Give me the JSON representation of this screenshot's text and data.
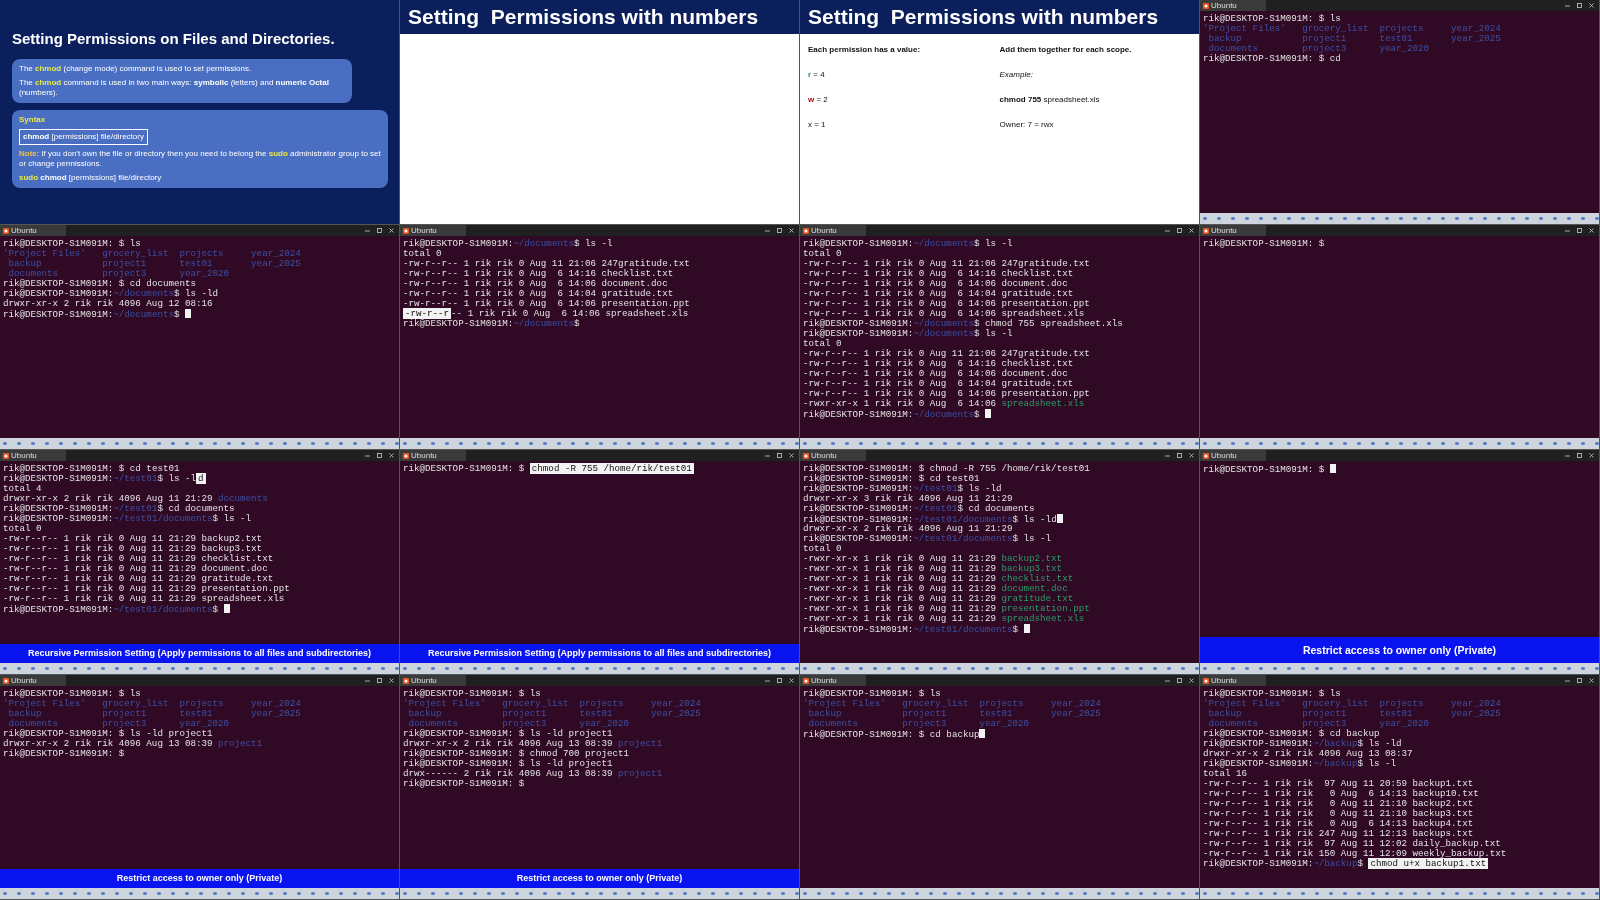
{
  "frames": [
    {
      "kind": "slide_intro",
      "title": "Setting Permissions on Files and Directories.",
      "paragraphs": [
        {
          "segments": [
            {
              "text": "The "
            },
            {
              "text": "chmod",
              "kind": "keyword"
            },
            {
              "text": " (change mode) command is used to set permissions."
            }
          ]
        },
        {
          "segments": [
            {
              "text": "The "
            },
            {
              "text": "chmod",
              "kind": "keyword"
            },
            {
              "text": " command is used in two main ways: "
            },
            {
              "text": "symbolic",
              "kind": "bold"
            },
            {
              "text": " (letters) and "
            },
            {
              "text": "numeric Octal",
              "kind": "bold"
            },
            {
              "text": " (numbers)."
            }
          ]
        }
      ],
      "syntax": {
        "heading": "Syntax",
        "code": [
          {
            "text": "chmod",
            "kind": "bold"
          },
          {
            "text": " [permissions] file/directory"
          }
        ],
        "note": [
          {
            "text": "Note",
            "kind": "note"
          },
          {
            "text": ": If you don't own the file or directory then you need to belong the  "
          },
          {
            "text": "sudo",
            "kind": "keyword"
          },
          {
            "text": " administrator group to set or change permissions."
          }
        ],
        "example": [
          {
            "text": "sudo",
            "kind": "keyword"
          },
          {
            "text": " chmod",
            "kind": "bold"
          },
          {
            "text": " [permissions] file/directory"
          }
        ]
      }
    },
    {
      "kind": "slide_numbers",
      "title": "Setting  Permissions with numbers"
    },
    {
      "kind": "slide_numbers",
      "title": "Setting  Permissions with numbers",
      "left": [
        {
          "segments": [
            {
              "text": "Each permission has a value:",
              "kind": "bold"
            }
          ]
        },
        {
          "segments": [
            {
              "text": "r",
              "kind": "green"
            },
            {
              "text": " = 4"
            }
          ]
        },
        {
          "segments": [
            {
              "text": "w",
              "kind": "red"
            },
            {
              "text": " = 2"
            }
          ]
        },
        {
          "segments": [
            {
              "text": "x = 1"
            }
          ]
        }
      ],
      "right": [
        {
          "segments": [
            {
              "text": "Add them together for each scope.",
              "kind": "bold"
            }
          ]
        },
        {
          "segments": [
            {
              "text": "Example:",
              "kind": "italic"
            }
          ]
        },
        {
          "segments": [
            {
              "text": "chmod 755",
              "kind": "bold"
            },
            {
              "text": " spreadsheet.xls"
            }
          ]
        },
        {
          "segments": [
            {
              "text": "Owner: 7 = rwx"
            }
          ]
        }
      ]
    },
    {
      "kind": "terminal",
      "tab_title": "Ubuntu",
      "lines": [
        {
          "kind": "prompt",
          "prompt": "rik@DESKTOP-S1M091M:",
          "input": " $ ls"
        },
        {
          "kind": "listing",
          "text": "'Project Files'   grocery_list  projects     year_2024"
        },
        {
          "kind": "listing",
          "text": " backup           project1      test01       year_2025"
        },
        {
          "kind": "listing",
          "text": " documents        project3      year_2020"
        },
        {
          "kind": "prompt",
          "prompt": "rik@DESKTOP-S1M091M:",
          "input": " $ cd"
        }
      ]
    },
    {
      "kind": "terminal",
      "tab_title": "Ubuntu",
      "lines": [
        {
          "kind": "prompt",
          "prompt": "rik@DESKTOP-S1M091M:",
          "input": " $ ls"
        },
        {
          "kind": "listing",
          "text": "'Project Files'   grocery_list  projects     year_2024"
        },
        {
          "kind": "listing",
          "text": " backup           project1      test01       year_2025"
        },
        {
          "kind": "listing",
          "text": " documents        project3      year_2020"
        },
        {
          "kind": "prompt",
          "prompt": "rik@DESKTOP-S1M091M:",
          "input": " $ cd documents"
        },
        {
          "kind": "prompt",
          "prompt": "rik@DESKTOP-S1M091M:",
          "path": "~/documents",
          "input": "$ ls -ld"
        },
        {
          "kind": "output",
          "text": "drwxr-xr-x 2 rik rik 4096 Aug 12 08:16"
        },
        {
          "kind": "prompt",
          "prompt": "rik@DESKTOP-S1M091M:",
          "path": "~/documents",
          "input": "$ ",
          "cursor": true
        }
      ]
    },
    {
      "kind": "terminal",
      "tab_title": "Ubuntu",
      "lines": [
        {
          "kind": "prompt",
          "prompt": "rik@DESKTOP-S1M091M:",
          "path": "~/documents",
          "input": "$ ls -l"
        },
        {
          "kind": "output",
          "text": "total 0"
        },
        {
          "kind": "output",
          "text": "-rw-r--r-- 1 rik rik 0 Aug 11 21:06 247gratitude.txt"
        },
        {
          "kind": "output",
          "text": "-rw-r--r-- 1 rik rik 0 Aug  6 14:16 checklist.txt"
        },
        {
          "kind": "output",
          "text": "-rw-r--r-- 1 rik rik 0 Aug  6 14:06 document.doc"
        },
        {
          "kind": "output",
          "text": "-rw-r--r-- 1 rik rik 0 Aug  6 14:04 gratitude.txt"
        },
        {
          "kind": "output",
          "text": "-rw-r--r-- 1 rik rik 0 Aug  6 14:06 presentation.ppt"
        },
        {
          "kind": "output",
          "selected_prefix": "-rw-r--r",
          "text": "-- 1 rik rik 0 Aug  6 14:06 spreadsheet.xls"
        },
        {
          "kind": "prompt",
          "prompt": "rik@DESKTOP-S1M091M:",
          "path": "~/documents",
          "input": "$"
        }
      ]
    },
    {
      "kind": "terminal",
      "tab_title": "Ubuntu",
      "lines": [
        {
          "kind": "prompt",
          "prompt": "rik@DESKTOP-S1M091M:",
          "path": "~/documents",
          "input": "$ ls -l"
        },
        {
          "kind": "output",
          "text": "total 0"
        },
        {
          "kind": "output",
          "text": "-rw-r--r-- 1 rik rik 0 Aug 11 21:06 247gratitude.txt"
        },
        {
          "kind": "output",
          "text": "-rw-r--r-- 1 rik rik 0 Aug  6 14:16 checklist.txt"
        },
        {
          "kind": "output",
          "text": "-rw-r--r-- 1 rik rik 0 Aug  6 14:06 document.doc"
        },
        {
          "kind": "output",
          "text": "-rw-r--r-- 1 rik rik 0 Aug  6 14:04 gratitude.txt"
        },
        {
          "kind": "output",
          "text": "-rw-r--r-- 1 rik rik 0 Aug  6 14:06 presentation.ppt"
        },
        {
          "kind": "output",
          "text": "-rw-r--r-- 1 rik rik 0 Aug  6 14:06 spreadsheet.xls"
        },
        {
          "kind": "prompt",
          "prompt": "rik@DESKTOP-S1M091M:",
          "path": "~/documents",
          "input": "$ chmod 755 spreadsheet.xls"
        },
        {
          "kind": "prompt",
          "prompt": "rik@DESKTOP-S1M091M:",
          "path": "~/documents",
          "input": "$ ls -l"
        },
        {
          "kind": "output",
          "text": "total 0"
        },
        {
          "kind": "output",
          "text": "-rw-r--r-- 1 rik rik 0 Aug 11 21:06 247gratitude.txt"
        },
        {
          "kind": "output",
          "text": "-rw-r--r-- 1 rik rik 0 Aug  6 14:16 checklist.txt"
        },
        {
          "kind": "output",
          "text": "-rw-r--r-- 1 rik rik 0 Aug  6 14:06 document.doc"
        },
        {
          "kind": "output",
          "text": "-rw-r--r-- 1 rik rik 0 Aug  6 14:04 gratitude.txt"
        },
        {
          "kind": "output",
          "text": "-rw-r--r-- 1 rik rik 0 Aug  6 14:06 presentation.ppt"
        },
        {
          "kind": "exec_entry",
          "text": "-rwxr-xr-x 1 rik rik 0 Aug  6 14:06 ",
          "name": "spreadsheet.xls"
        },
        {
          "kind": "prompt",
          "prompt": "rik@DESKTOP-S1M091M:",
          "path": "~/documents",
          "input": "$ ",
          "cursor": true
        }
      ]
    },
    {
      "kind": "terminal",
      "tab_title": "Ubuntu",
      "lines": [
        {
          "kind": "prompt",
          "prompt": "rik@DESKTOP-S1M091M:",
          "input": " $"
        }
      ]
    },
    {
      "kind": "terminal",
      "tab_title": "Ubuntu",
      "caption": "Recursive Permission Setting (Apply permissions to all files and subdirectories)",
      "lines": [
        {
          "kind": "prompt",
          "prompt": "rik@DESKTOP-S1M091M:",
          "input": " $ cd test01"
        },
        {
          "kind": "prompt",
          "prompt": "rik@DESKTOP-S1M091M:",
          "path": "~/test01",
          "input": "$ ls -l",
          "selection": "d"
        },
        {
          "kind": "output",
          "text": "total 4"
        },
        {
          "kind": "dir_entry",
          "text": "drwxr-xr-x 2 rik rik 4096 Aug 11 21:29 ",
          "name": "documents"
        },
        {
          "kind": "prompt",
          "prompt": "rik@DESKTOP-S1M091M:",
          "path": "~/test01",
          "input": "$ cd documents"
        },
        {
          "kind": "prompt",
          "prompt": "rik@DESKTOP-S1M091M:",
          "path": "~/test01/documents",
          "input": "$ ls -l"
        },
        {
          "kind": "output",
          "text": "total 0"
        },
        {
          "kind": "output",
          "text": "-rw-r--r-- 1 rik rik 0 Aug 11 21:29 backup2.txt"
        },
        {
          "kind": "output",
          "text": "-rw-r--r-- 1 rik rik 0 Aug 11 21:29 backup3.txt"
        },
        {
          "kind": "output",
          "text": "-rw-r--r-- 1 rik rik 0 Aug 11 21:29 checklist.txt"
        },
        {
          "kind": "output",
          "text": "-rw-r--r-- 1 rik rik 0 Aug 11 21:29 document.doc"
        },
        {
          "kind": "output",
          "text": "-rw-r--r-- 1 rik rik 0 Aug 11 21:29 gratitude.txt"
        },
        {
          "kind": "output",
          "text": "-rw-r--r-- 1 rik rik 0 Aug 11 21:29 presentation.ppt"
        },
        {
          "kind": "output",
          "text": "-rw-r--r-- 1 rik rik 0 Aug 11 21:29 spreadsheet.xls"
        },
        {
          "kind": "prompt",
          "prompt": "rik@DESKTOP-S1M091M:",
          "path": "~/test01/documents",
          "input": "$ ",
          "cursor": true
        }
      ]
    },
    {
      "kind": "terminal",
      "tab_title": "Ubuntu",
      "caption": "Recursive Permission Setting (Apply permissions to all files and subdirectories)",
      "lines": [
        {
          "kind": "prompt",
          "prompt": "rik@DESKTOP-S1M091M:",
          "input": " $ ",
          "selection": "chmod -R 755 /home/rik/test01"
        }
      ]
    },
    {
      "kind": "terminal",
      "tab_title": "Ubuntu",
      "lines": [
        {
          "kind": "prompt",
          "prompt": "rik@DESKTOP-S1M091M:",
          "input": " $ chmod -R 755 /home/rik/test01"
        },
        {
          "kind": "prompt",
          "prompt": "rik@DESKTOP-S1M091M:",
          "input": " $ cd test01"
        },
        {
          "kind": "prompt",
          "prompt": "rik@DESKTOP-S1M091M:",
          "path": "~/test01",
          "input": "$ ls -ld"
        },
        {
          "kind": "output",
          "text": "drwxr-xr-x 3 rik rik 4096 Aug 11 21:29"
        },
        {
          "kind": "prompt",
          "prompt": "rik@DESKTOP-S1M091M:",
          "path": "~/test01",
          "input": "$ cd documents"
        },
        {
          "kind": "prompt",
          "prompt": "rik@DESKTOP-S1M091M:",
          "path": "~/test01/documents",
          "input": "$ ls -ld",
          "cursor": true
        },
        {
          "kind": "output",
          "text": "drwxr-xr-x 2 rik rik 4096 Aug 11 21:29"
        },
        {
          "kind": "prompt",
          "prompt": "rik@DESKTOP-S1M091M:",
          "path": "~/test01/documents",
          "input": "$ ls -l"
        },
        {
          "kind": "output",
          "text": "total 0"
        },
        {
          "kind": "exec_entry",
          "text": "-rwxr-xr-x 1 rik rik 0 Aug 11 21:29 ",
          "name": "backup2.txt"
        },
        {
          "kind": "exec_entry",
          "text": "-rwxr-xr-x 1 rik rik 0 Aug 11 21:29 ",
          "name": "backup3.txt"
        },
        {
          "kind": "exec_entry",
          "text": "-rwxr-xr-x 1 rik rik 0 Aug 11 21:29 ",
          "name": "checklist.txt"
        },
        {
          "kind": "exec_entry",
          "text": "-rwxr-xr-x 1 rik rik 0 Aug 11 21:29 ",
          "name": "document.doc"
        },
        {
          "kind": "exec_entry",
          "text": "-rwxr-xr-x 1 rik rik 0 Aug 11 21:29 ",
          "name": "gratitude.txt"
        },
        {
          "kind": "exec_entry",
          "text": "-rwxr-xr-x 1 rik rik 0 Aug 11 21:29 ",
          "name": "presentation.ppt"
        },
        {
          "kind": "exec_entry",
          "text": "-rwxr-xr-x 1 rik rik 0 Aug 11 21:29 ",
          "name": "spreadsheet.xls"
        },
        {
          "kind": "prompt",
          "prompt": "rik@DESKTOP-S1M091M:",
          "path": "~/test01/documents",
          "input": "$ ",
          "cursor": true
        }
      ]
    },
    {
      "kind": "terminal",
      "tab_title": "Ubuntu",
      "caption": "Restrict access to owner only (Private)",
      "lines": [
        {
          "kind": "prompt",
          "prompt": "rik@DESKTOP-S1M091M:",
          "input": " $ ",
          "cursor": true
        }
      ]
    },
    {
      "kind": "terminal",
      "tab_title": "Ubuntu",
      "caption": "Restrict access to owner only (Private)",
      "lines": [
        {
          "kind": "prompt",
          "prompt": "rik@DESKTOP-S1M091M:",
          "input": " $ ls"
        },
        {
          "kind": "listing",
          "text": "'Project Files'   grocery_list  projects     year_2024"
        },
        {
          "kind": "listing",
          "text": " backup           project1      test01       year_2025"
        },
        {
          "kind": "listing",
          "text": " documents        project3      year_2020"
        },
        {
          "kind": "prompt",
          "prompt": "rik@DESKTOP-S1M091M:",
          "input": " $ ls -ld project1"
        },
        {
          "kind": "dir_entry",
          "text": "drwxr-xr-x 2 rik rik 4096 Aug 13 08:39 ",
          "name": "project1"
        },
        {
          "kind": "prompt",
          "prompt": "rik@DESKTOP-S1M091M:",
          "input": " $"
        }
      ]
    },
    {
      "kind": "terminal",
      "tab_title": "Ubuntu",
      "caption": "Restrict access to owner only (Private)",
      "lines": [
        {
          "kind": "prompt",
          "prompt": "rik@DESKTOP-S1M091M:",
          "input": " $ ls"
        },
        {
          "kind": "listing",
          "text": "'Project Files'   grocery_list  projects     year_2024"
        },
        {
          "kind": "listing",
          "text": " backup           project1      test01       year_2025"
        },
        {
          "kind": "listing",
          "text": " documents        project3      year_2020"
        },
        {
          "kind": "prompt",
          "prompt": "rik@DESKTOP-S1M091M:",
          "input": " $ ls -ld project1"
        },
        {
          "kind": "dir_entry",
          "text": "drwxr-xr-x 2 rik rik 4096 Aug 13 08:39 ",
          "name": "project1"
        },
        {
          "kind": "prompt",
          "prompt": "rik@DESKTOP-S1M091M:",
          "input": " $ chmod 700 project1"
        },
        {
          "kind": "prompt",
          "prompt": "rik@DESKTOP-S1M091M:",
          "input": " $ ls -ld project1"
        },
        {
          "kind": "dir_entry",
          "text": "drwx------ 2 rik rik 4096 Aug 13 08:39 ",
          "name": "project1"
        },
        {
          "kind": "prompt",
          "prompt": "rik@DESKTOP-S1M091M:",
          "input": " $"
        }
      ]
    },
    {
      "kind": "terminal",
      "tab_title": "Ubuntu",
      "lines": [
        {
          "kind": "prompt",
          "prompt": "rik@DESKTOP-S1M091M:",
          "input": " $ ls"
        },
        {
          "kind": "listing",
          "text": "'Project Files'   grocery_list  projects     year_2024"
        },
        {
          "kind": "listing",
          "text": " backup           project1      test01       year_2025"
        },
        {
          "kind": "listing",
          "text": " documents        project3      year_2020"
        },
        {
          "kind": "prompt",
          "prompt": "rik@DESKTOP-S1M091M:",
          "input": " $ cd backup",
          "cursor": true
        }
      ]
    },
    {
      "kind": "terminal",
      "tab_title": "Ubuntu",
      "lines": [
        {
          "kind": "prompt",
          "prompt": "rik@DESKTOP-S1M091M:",
          "input": " $ ls"
        },
        {
          "kind": "listing",
          "text": "'Project Files'   grocery_list  projects     year_2024"
        },
        {
          "kind": "listing",
          "text": " backup           project1      test01       year_2025"
        },
        {
          "kind": "listing",
          "text": " documents        project3      year_2020"
        },
        {
          "kind": "prompt",
          "prompt": "rik@DESKTOP-S1M091M:",
          "input": " $ cd backup"
        },
        {
          "kind": "prompt",
          "prompt": "rik@DESKTOP-S1M091M:",
          "path": "~/backup",
          "input": "$ ls -ld"
        },
        {
          "kind": "output",
          "text": "drwxr-xr-x 2 rik rik 4096 Aug 13 08:37"
        },
        {
          "kind": "prompt",
          "prompt": "rik@DESKTOP-S1M091M:",
          "path": "~/backup",
          "input": "$ ls -l"
        },
        {
          "kind": "output",
          "text": "total 16"
        },
        {
          "kind": "output",
          "text": "-rw-r--r-- 1 rik rik  97 Aug 11 20:59 backup1.txt"
        },
        {
          "kind": "output",
          "text": "-rw-r--r-- 1 rik rik   0 Aug  6 14:13 backup10.txt"
        },
        {
          "kind": "output",
          "text": "-rw-r--r-- 1 rik rik   0 Aug 11 21:10 backup2.txt"
        },
        {
          "kind": "output",
          "text": "-rw-r--r-- 1 rik rik   0 Aug 11 21:10 backup3.txt"
        },
        {
          "kind": "output",
          "text": "-rw-r--r-- 1 rik rik   0 Aug  6 14:13 backup4.txt"
        },
        {
          "kind": "output",
          "text": "-rw-r--r-- 1 rik rik 247 Aug 11 12:13 backups.txt"
        },
        {
          "kind": "output",
          "text": "-rw-r--r-- 1 rik rik  97 Aug 11 12:02 daily_backup.txt"
        },
        {
          "kind": "output",
          "text": "-rw-r--r-- 1 rik rik 150 Aug 11 12:09 weekly_backup.txt"
        },
        {
          "kind": "prompt",
          "prompt": "rik@DESKTOP-S1M091M:",
          "path": "~/backup",
          "input": "$ ",
          "selection": "chmod u+x backup1.txt"
        }
      ]
    }
  ]
}
